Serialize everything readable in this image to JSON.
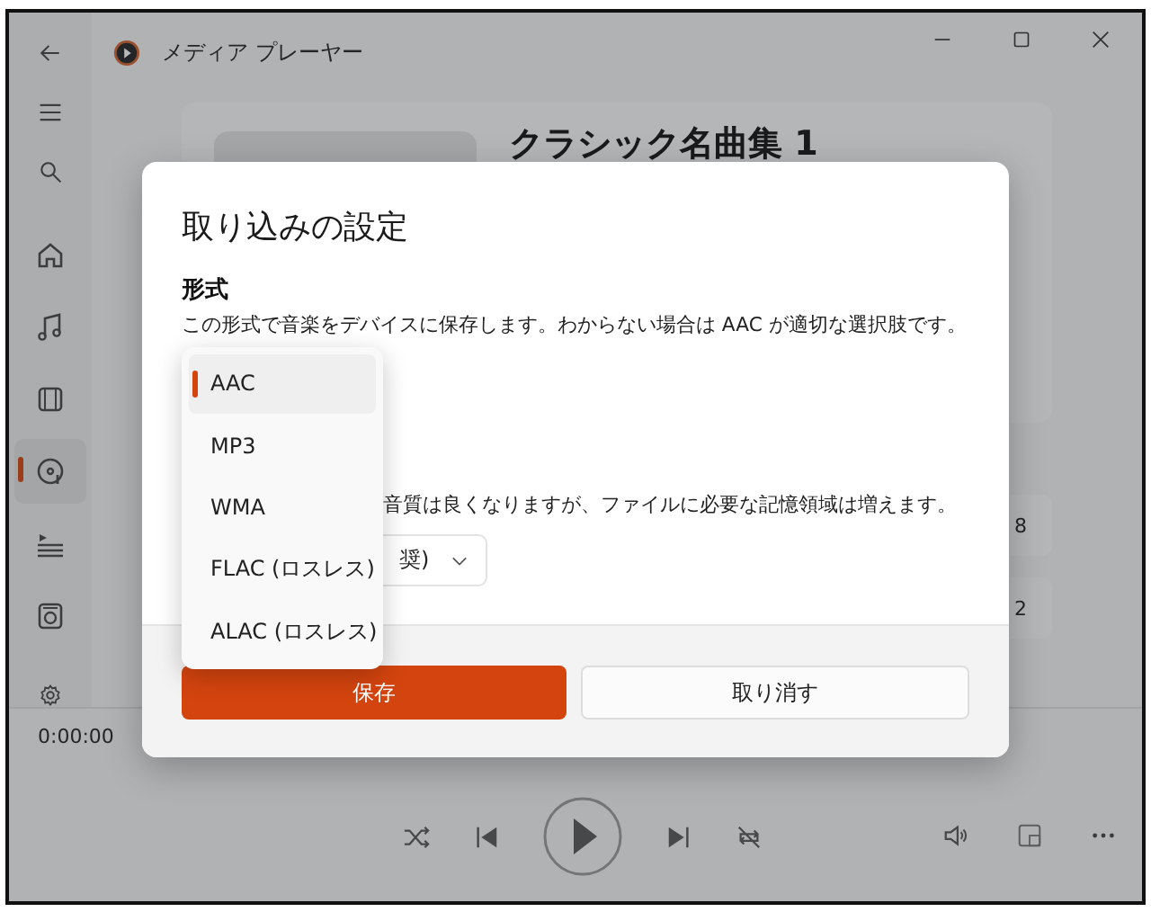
{
  "window": {
    "title": "メディア プレーヤー"
  },
  "sidebar": {
    "items": [
      {
        "kind": "home",
        "selected": false
      },
      {
        "kind": "music",
        "selected": false
      },
      {
        "kind": "video",
        "selected": false
      },
      {
        "kind": "disc",
        "selected": true
      },
      {
        "kind": "playlist",
        "selected": false
      },
      {
        "kind": "device",
        "selected": false
      }
    ]
  },
  "header": {
    "album_title": "クラシック名曲集 1"
  },
  "background_rows": [
    "8",
    "2"
  ],
  "player": {
    "time": "0:00:00"
  },
  "dialog": {
    "title": "取り込みの設定",
    "heading": "形式",
    "description": "この形式で音楽をデバイスに保存します。わからない場合は AAC が適切な選択肢です。",
    "quality_note": "音質は良くなりますが、ファイルに必要な記憶領域は増えます。",
    "quality_value": "奨)",
    "buttons": [
      {
        "label": "保存",
        "primary": true
      },
      {
        "label": "取り消す",
        "primary": false
      }
    ]
  },
  "format_menu": {
    "options": [
      {
        "label": "AAC",
        "selected": true
      },
      {
        "label": "MP3",
        "selected": false
      },
      {
        "label": "WMA",
        "selected": false
      },
      {
        "label": "FLAC (ロスレス)",
        "selected": false
      },
      {
        "label": "ALAC (ロスレス)",
        "selected": false
      }
    ]
  }
}
